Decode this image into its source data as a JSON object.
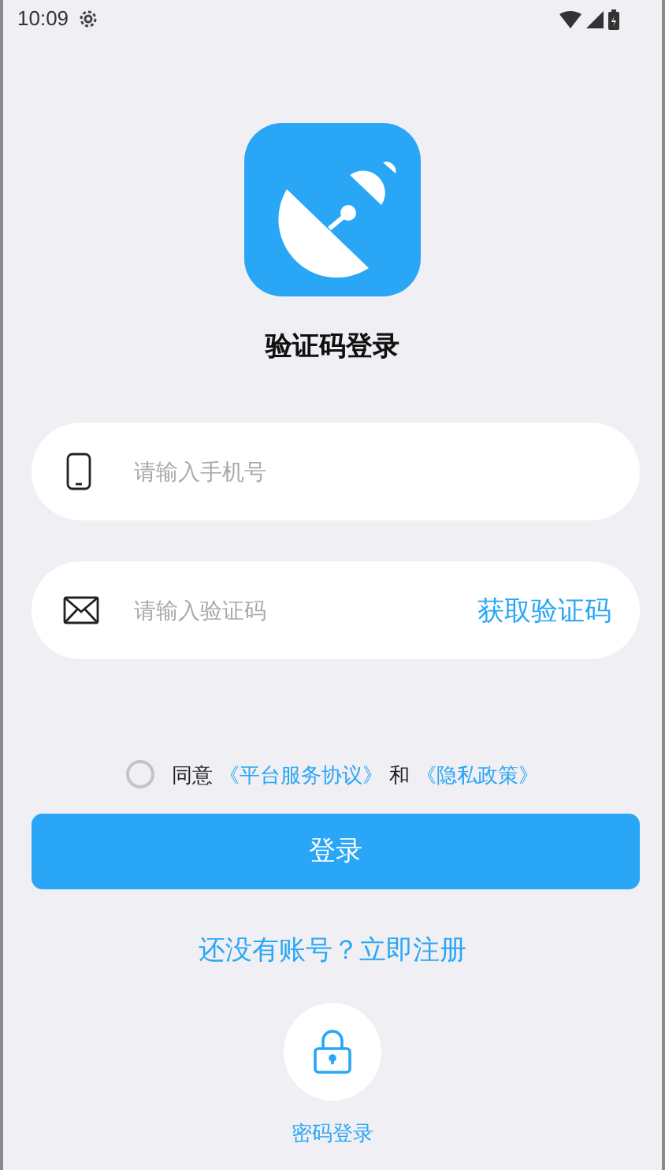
{
  "status_bar": {
    "time": "10:09"
  },
  "title": "验证码登录",
  "phone_field": {
    "placeholder": "请输入手机号"
  },
  "code_field": {
    "placeholder": "请输入验证码",
    "action": "获取验证码"
  },
  "agreement": {
    "checked": false,
    "prefix": "同意",
    "terms_link": "《平台服务协议》",
    "conjunction": "和",
    "privacy_link": "《隐私政策》"
  },
  "login_button": "登录",
  "register_link": "还没有账号？立即注册",
  "password_login": {
    "label": "密码登录"
  }
}
